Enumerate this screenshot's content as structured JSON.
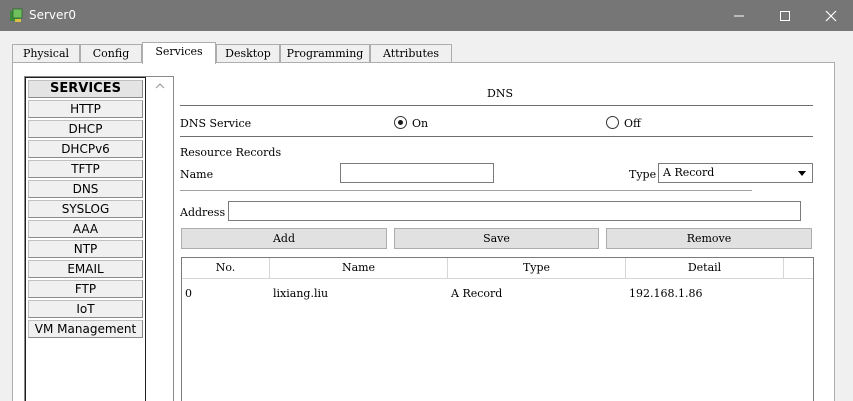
{
  "window": {
    "title": "Server0"
  },
  "tabs": [
    {
      "label": "Physical"
    },
    {
      "label": "Config"
    },
    {
      "label": "Services",
      "active": true
    },
    {
      "label": "Desktop"
    },
    {
      "label": "Programming"
    },
    {
      "label": "Attributes"
    }
  ],
  "services": {
    "header": "SERVICES",
    "items": [
      "HTTP",
      "DHCP",
      "DHCPv6",
      "TFTP",
      "DNS",
      "SYSLOG",
      "AAA",
      "NTP",
      "EMAIL",
      "FTP",
      "IoT",
      "VM Management"
    ]
  },
  "dns": {
    "title": "DNS",
    "service_label": "DNS Service",
    "on_label": "On",
    "off_label": "Off",
    "selected": "On",
    "resource_records_label": "Resource Records",
    "name_label": "Name",
    "name_value": "",
    "type_label": "Type",
    "type_value": "A Record",
    "address_label": "Address",
    "address_value": "",
    "add_label": "Add",
    "save_label": "Save",
    "remove_label": "Remove",
    "columns": [
      "No.",
      "Name",
      "Type",
      "Detail"
    ],
    "rows": [
      {
        "no": "0",
        "name": "lixiang.liu",
        "type": "A Record",
        "detail": "192.168.1.86"
      }
    ]
  }
}
